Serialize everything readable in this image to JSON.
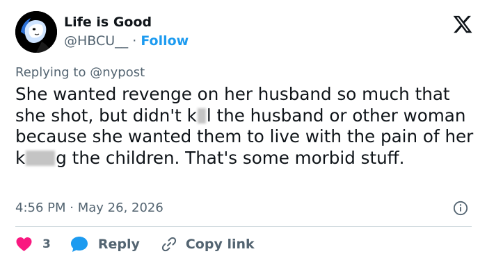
{
  "colors": {
    "accent": "#1d9bf0",
    "like": "#f91880",
    "text": "#0f1419",
    "muted": "#536471",
    "divider": "#cfd9de"
  },
  "author": {
    "name": "Life is Good",
    "handle": "@HBCU__",
    "separator": "·",
    "follow_label": "Follow",
    "avatar_icon": "avatar-portrait"
  },
  "brand_icon": "x-logo-icon",
  "reply_context": {
    "prefix": "Replying to",
    "mention": "@nypost"
  },
  "tweet": {
    "segments": [
      "She wanted revenge on her husband so much that she shot, but didn't k",
      "l the husband or other woman because she wanted them to live with the pain of her k",
      "g the children. That's some morbid stuff."
    ]
  },
  "meta": {
    "time": "4:56 PM",
    "separator": "·",
    "date": "May 26, 2026",
    "info_icon": "info-icon"
  },
  "actions": {
    "like_count": "3",
    "reply_label": "Reply",
    "copy_label": "Copy link"
  }
}
